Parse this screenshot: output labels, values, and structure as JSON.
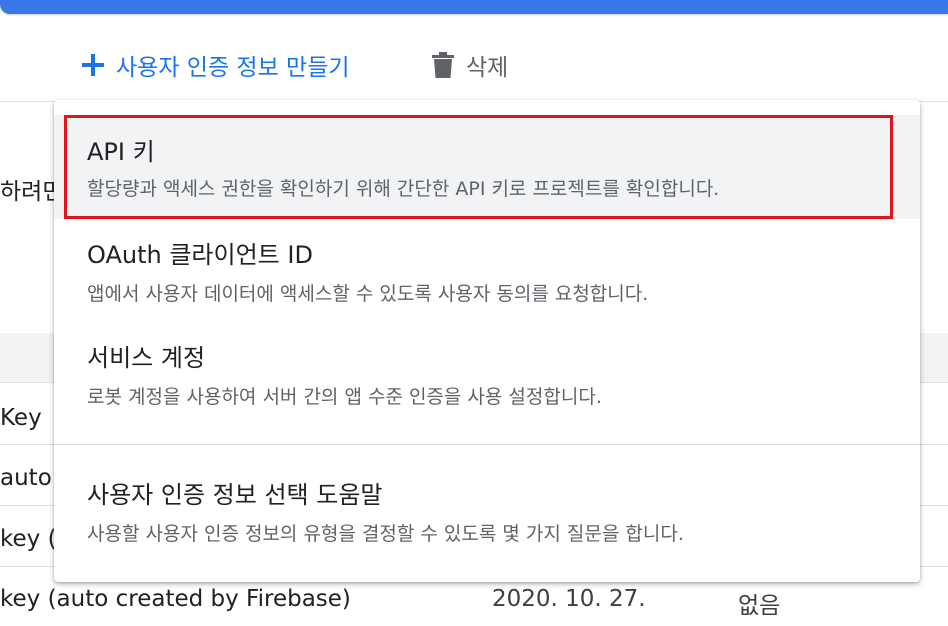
{
  "toolbar": {
    "create_label": "사용자 인증 정보 만들기",
    "delete_label": "삭제"
  },
  "background": {
    "left_text": "하려면",
    "row1_name": "Key",
    "row2_name": "auto",
    "row3_name": "key (a",
    "row4_name": "key (auto created by Firebase)",
    "row4_date": "2020. 10. 27.",
    "row4_restriction": "없음"
  },
  "menu": {
    "items": [
      {
        "title": "API 키",
        "desc": "할당량과 액세스 권한을 확인하기 위해 간단한 API 키로 프로젝트를 확인합니다."
      },
      {
        "title": "OAuth 클라이언트 ID",
        "desc": "앱에서 사용자 데이터에 액세스할 수 있도록 사용자 동의를 요청합니다."
      },
      {
        "title": "서비스 계정",
        "desc": "로봇 계정을 사용하여 서버 간의 앱 수준 인증을 사용 설정합니다."
      },
      {
        "title": "사용자 인증 정보 선택 도움말",
        "desc": "사용할 사용자 인증 정보의 유형을 결정할 수 있도록 몇 가지 질문을 합니다."
      }
    ]
  },
  "colors": {
    "accent": "#1a73e8",
    "highlight_border": "#e0141b",
    "top_bar": "#3b78e7"
  },
  "icons": {
    "create": "plus-icon",
    "delete": "trash-icon"
  }
}
